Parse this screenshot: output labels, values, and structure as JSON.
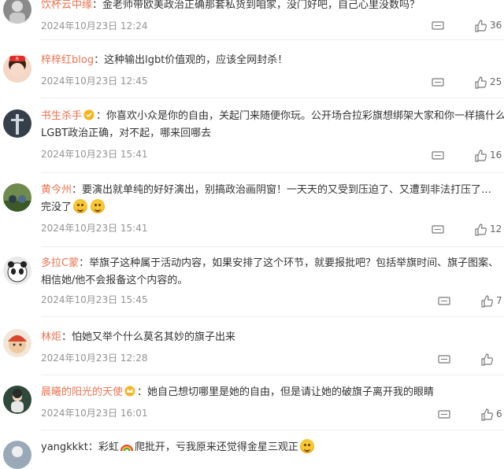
{
  "colors": {
    "username": "#eb7350",
    "text": "#333333",
    "meta": "#939393",
    "divider": "#ededed"
  },
  "comments": [
    {
      "username": "饮杯云中缘",
      "text": "金老师带欧美政治正确那套私货到咱家，没门好吧，自己心里没数吗？",
      "time": "2024年10月23日 12:24",
      "likes": "36"
    },
    {
      "username": "梓梓红blog",
      "text": "这种输出lgbt价值观的，应该全网封杀！",
      "time": "2024年10月23日 12:45",
      "likes": "25"
    },
    {
      "username": "书生杀手",
      "text": "你喜欢小众是你的自由，关起门来随便你玩。公开场合拉彩旗想绑架大家和你一样搞什么",
      "text2": "LGBT政治正确，对不起，哪来回哪去",
      "time": "2024年10月23日 15:41",
      "likes": "16",
      "badge_icon": "verified-badge-icon"
    },
    {
      "username": "黄今州",
      "text": "要演出就单纯的好好演出，别搞政治画阴窗！一天天的又受到压迫了、又遭到非法打压了…",
      "text2": "完没了",
      "time": "2024年10月23日 15:41",
      "likes": "12",
      "emoji_icons": [
        "smile-emoji-icon",
        "smile-emoji-icon"
      ]
    },
    {
      "username": "多拉C蒙",
      "text": "举旗子这种属于活动内容，如果安排了这个环节，就要报批吧？包括举旗时间、旗子图案、",
      "text2": "相信她/他不会报备这个内容的。",
      "time": "2024年10月23日 15:45",
      "likes": "7"
    },
    {
      "username": "林炬",
      "text": "怕她又举个什么莫名其妙的旗子出来",
      "time": "2024年10月23日 12:28",
      "likes": ""
    },
    {
      "username": "晨曦的阳光的天使",
      "text": "她自己想切哪里是她的自由，但是请让她的破旗子离开我的眼睛",
      "time": "2024年10月23日 16:01",
      "likes": "6",
      "badge_icon": "crown-badge-icon"
    },
    {
      "username": "yangkkkt",
      "text_a": "彩虹",
      "text_b": "爬批开，亏我原来还觉得金星三观正",
      "time": "",
      "likes": "",
      "emoji_icons": [
        "rainbow-emoji-icon",
        "laugh-cry-emoji-icon"
      ]
    }
  ]
}
